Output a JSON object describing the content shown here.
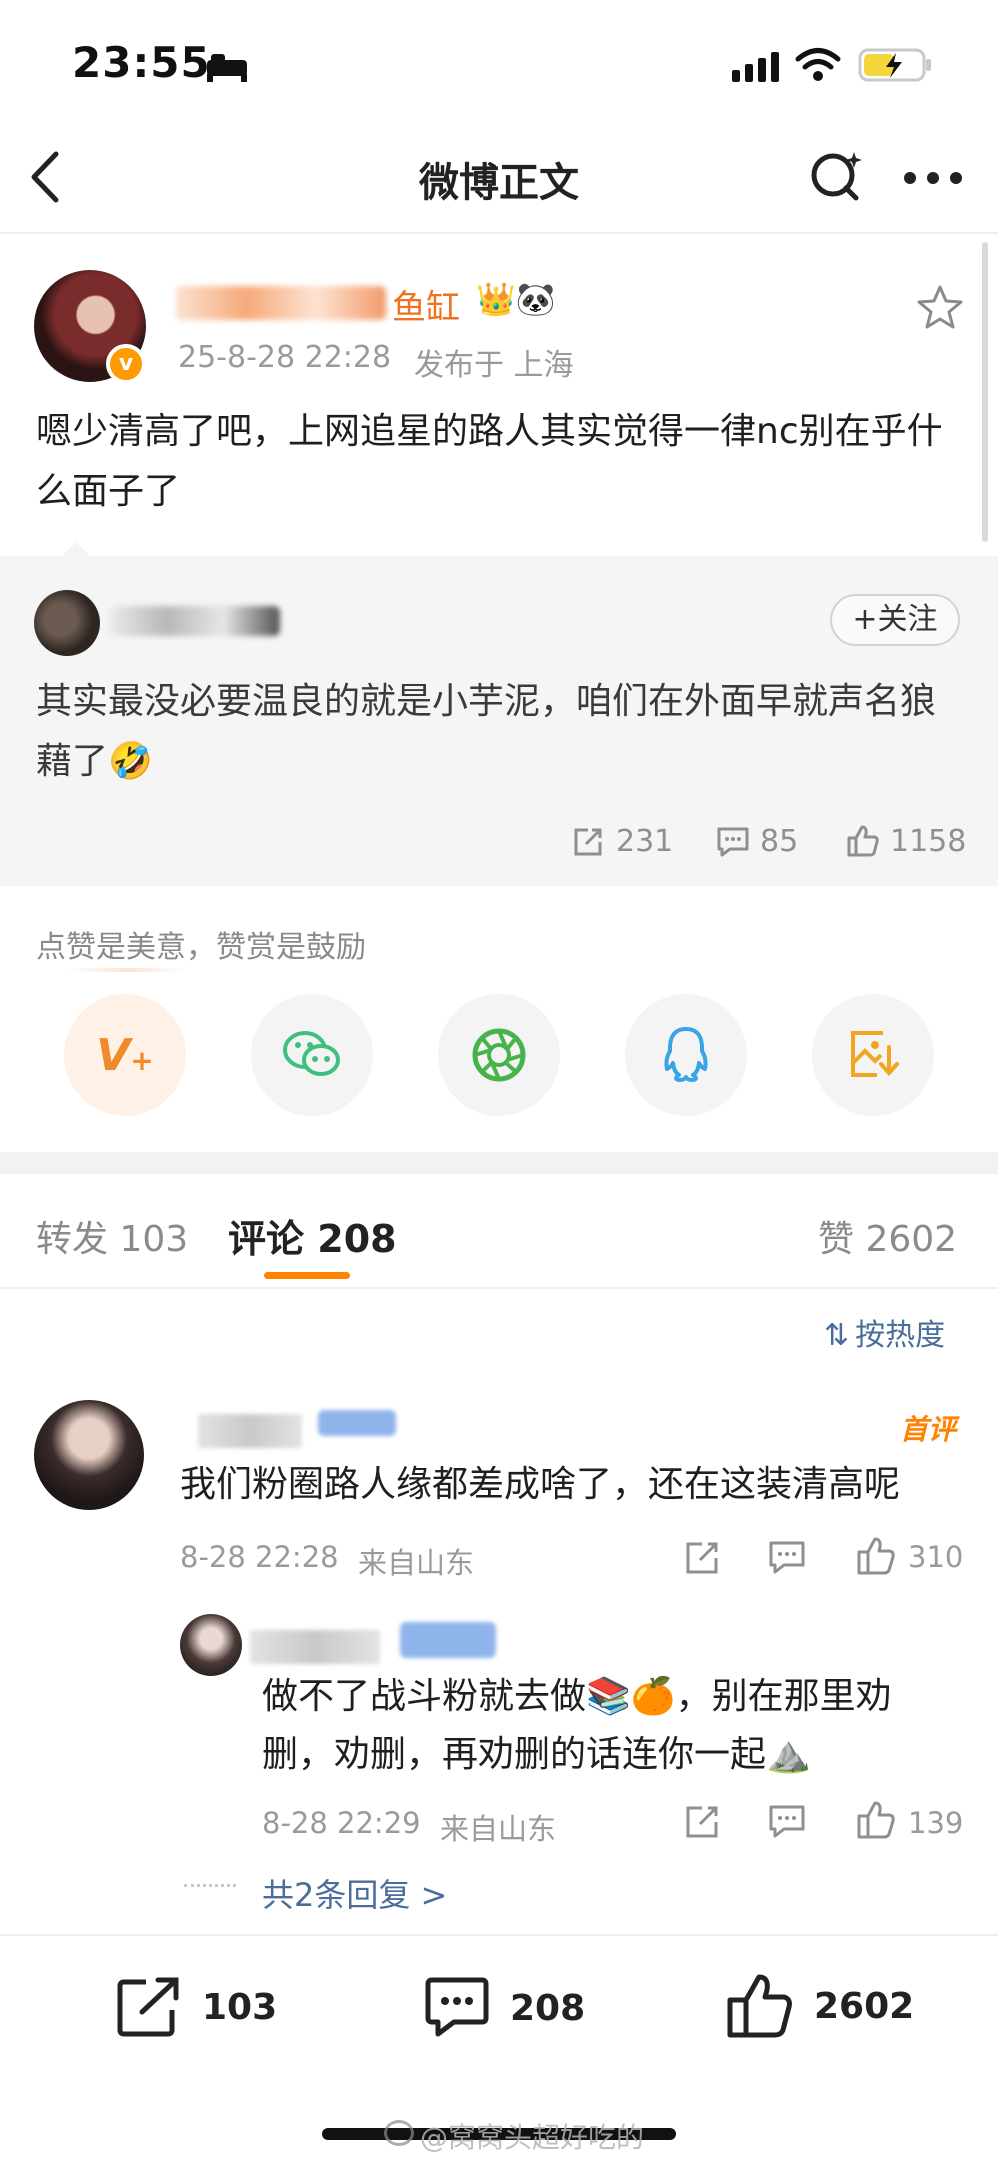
{
  "status_bar": {
    "time": "23:55"
  },
  "nav": {
    "title": "微博正文"
  },
  "post": {
    "author_visible": "鱼缸",
    "author_emoji": "👑🐼",
    "date": "25-8-28 22:28",
    "location": "发布于 上海",
    "text": "嗯少清高了吧，上网追星的路人其实觉得一律nc别在乎什么面子了"
  },
  "quoted": {
    "follow_label": "+关注",
    "text": "其实最没必要温良的就是小芋泥，咱们在外面早就声名狼藉了🤣",
    "reposts": "231",
    "comments": "85",
    "likes": "1158"
  },
  "share": {
    "hint": "点赞是美意，赞赏是鼓励",
    "icons": [
      "reward-icon",
      "wechat-icon",
      "moments-icon",
      "qq-icon",
      "save-image-icon"
    ]
  },
  "tabs": {
    "repost_label": "转发",
    "repost_count": "103",
    "comment_label": "评论",
    "comment_count": "208",
    "like_label": "赞",
    "like_count": "2602"
  },
  "sort": {
    "label": "按热度"
  },
  "comments": [
    {
      "badge": "首评",
      "text": "我们粉圈路人缘都差成啥了，还在这装清高呢",
      "time": "8-28 22:28",
      "location": "来自山东",
      "likes": "310"
    },
    {
      "text": "做不了战斗粉就去做📚🍊，别在那里劝删，劝删，再劝删的话连你一起⛰️",
      "time": "8-28 22:29",
      "location": "来自山东",
      "likes": "139"
    }
  ],
  "more_replies": "共2条回复 >",
  "bottom_bar": {
    "reposts": "103",
    "comments": "208",
    "likes": "2602"
  },
  "watermark": "@窝窝头超好吃的",
  "colors": {
    "accent_orange": "#ff8200",
    "link_blue": "#4a6d9c",
    "tab_underline": "#ff8200"
  }
}
